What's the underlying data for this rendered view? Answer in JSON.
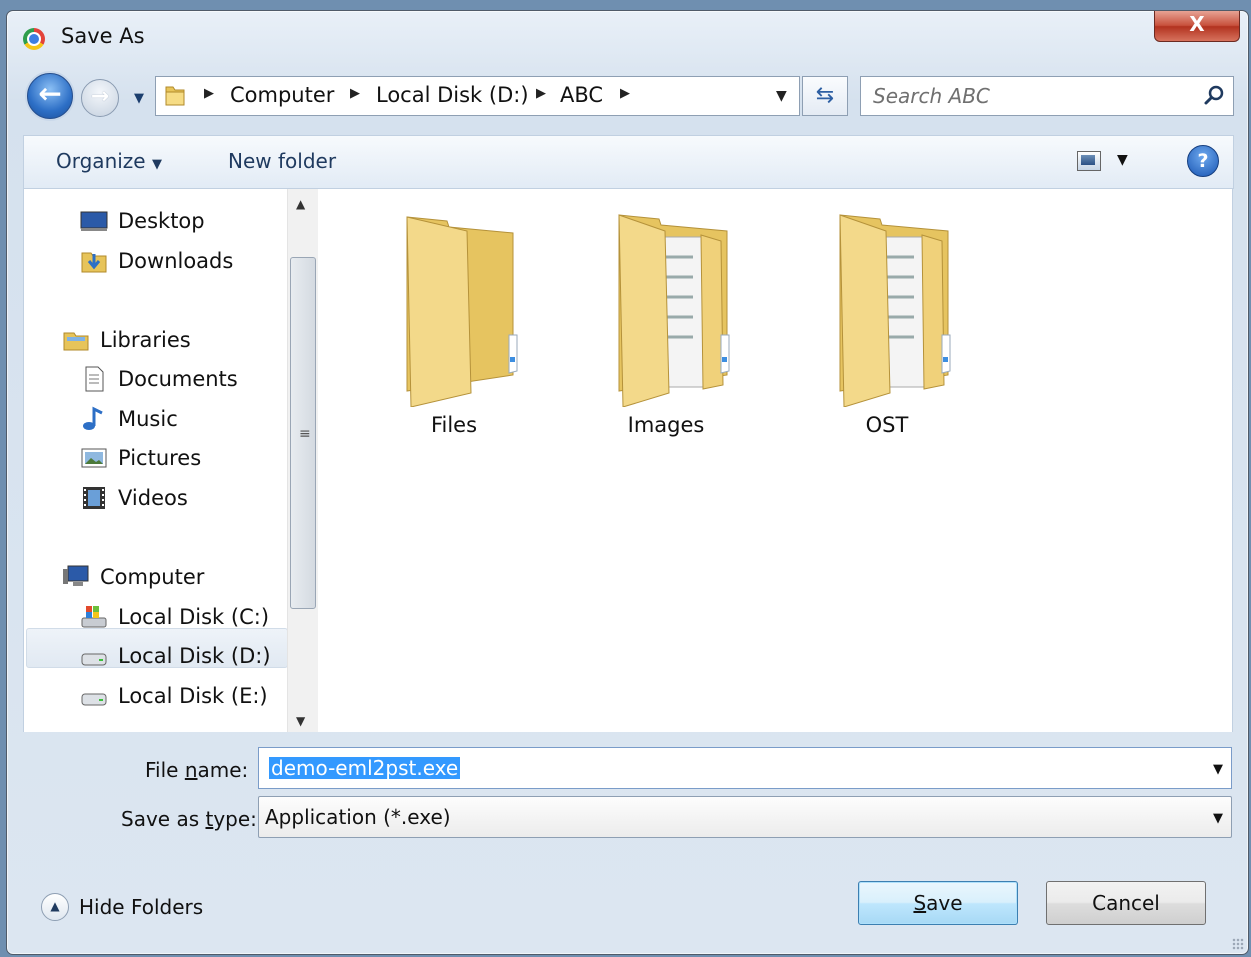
{
  "window": {
    "title": "Save As",
    "close_label": "X"
  },
  "address": {
    "crumbs": [
      "Computer",
      "Local Disk (D:)",
      "ABC"
    ],
    "search_placeholder": "Search ABC"
  },
  "toolbar": {
    "organize": "Organize",
    "new_folder": "New folder"
  },
  "nav": {
    "items": [
      {
        "label": "Desktop"
      },
      {
        "label": "Downloads"
      },
      {
        "label": "Libraries"
      },
      {
        "label": "Documents"
      },
      {
        "label": "Music"
      },
      {
        "label": "Pictures"
      },
      {
        "label": "Videos"
      },
      {
        "label": "Computer"
      },
      {
        "label": "Local Disk (C:)"
      },
      {
        "label": "Local Disk (D:)",
        "selected": true
      },
      {
        "label": "Local Disk (E:)"
      }
    ]
  },
  "content": {
    "folders": [
      {
        "name": "Files"
      },
      {
        "name": "Images"
      },
      {
        "name": "OST"
      }
    ]
  },
  "form": {
    "file_name_label_pre": "File ",
    "file_name_label_u": "n",
    "file_name_label_post": "ame:",
    "file_name_value": "demo-eml2pst.exe",
    "save_type_label_pre": "Save as ",
    "save_type_label_u": "t",
    "save_type_label_post": "ype:",
    "save_type_value": "Application (*.exe)"
  },
  "footer": {
    "hide_folders": "Hide Folders",
    "save_u": "S",
    "save_rest": "ave",
    "cancel": "Cancel"
  },
  "colors": {
    "selection": "#3399ff",
    "accent": "#2d6fc6"
  }
}
